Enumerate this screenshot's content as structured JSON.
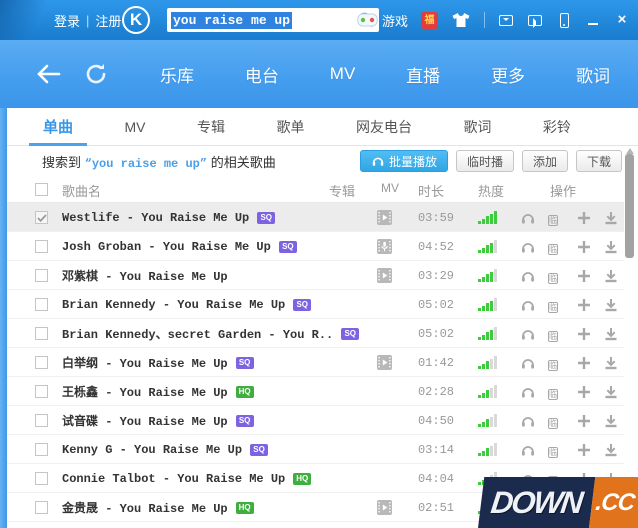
{
  "titlebar": {
    "login": "登录",
    "sep": "|",
    "register": "注册",
    "logo_letter": "K",
    "search": {
      "value": "you raise me up"
    },
    "game_label": "游戏",
    "lucky_glyph": "福"
  },
  "navbar": {
    "items": [
      "乐库",
      "电台",
      "MV",
      "直播",
      "更多",
      "歌词"
    ]
  },
  "tabs": [
    {
      "label": "单曲",
      "active": true
    },
    {
      "label": "MV",
      "active": false
    },
    {
      "label": "专辑",
      "active": false
    },
    {
      "label": "歌单",
      "active": false
    },
    {
      "label": "网友电台",
      "active": false
    },
    {
      "label": "歌词",
      "active": false
    },
    {
      "label": "彩铃",
      "active": false
    }
  ],
  "resultbar": {
    "prefix": "搜索到",
    "query": "“you raise me up”",
    "suffix": "的相关歌曲",
    "buttons": [
      {
        "label": "批量播放",
        "primary": true
      },
      {
        "label": "临时播",
        "primary": false
      },
      {
        "label": "添加",
        "primary": false
      },
      {
        "label": "下载",
        "primary": false
      }
    ]
  },
  "table": {
    "headers": [
      "歌曲名",
      "专辑",
      "MV",
      "时长",
      "热度",
      "操作"
    ],
    "temp_icon_glyph": "临",
    "rows": [
      {
        "title": "Westlife - You Raise Me Up",
        "badge": "SQ",
        "mv": "video",
        "duration": "03:59",
        "heat": 5,
        "checked": true,
        "selected": true
      },
      {
        "title": "Josh Groban - You Raise Me Up",
        "badge": "SQ",
        "mv": "mic",
        "duration": "04:52",
        "heat": 4,
        "checked": false,
        "selected": false
      },
      {
        "title": "邓紫棋 - You Raise Me Up",
        "badge": null,
        "mv": "video",
        "duration": "03:29",
        "heat": 4,
        "checked": false,
        "selected": false
      },
      {
        "title": "Brian Kennedy - You Raise Me Up",
        "badge": "SQ",
        "mv": null,
        "duration": "05:02",
        "heat": 4,
        "checked": false,
        "selected": false
      },
      {
        "title": "Brian Kennedy、secret Garden - You R..",
        "badge": "SQ",
        "mv": null,
        "duration": "05:02",
        "heat": 4,
        "checked": false,
        "selected": false
      },
      {
        "title": "白举纲 - You Raise Me Up",
        "badge": "SQ",
        "mv": "video",
        "duration": "01:42",
        "heat": 3,
        "checked": false,
        "selected": false
      },
      {
        "title": "王栎鑫 - You Raise Me Up",
        "badge": "HQ",
        "mv": null,
        "duration": "02:28",
        "heat": 3,
        "checked": false,
        "selected": false
      },
      {
        "title": "试音碟 - You Raise Me Up",
        "badge": "SQ",
        "mv": null,
        "duration": "04:50",
        "heat": 3,
        "checked": false,
        "selected": false
      },
      {
        "title": "Kenny G - You Raise Me Up",
        "badge": "SQ",
        "mv": null,
        "duration": "03:14",
        "heat": 3,
        "checked": false,
        "selected": false
      },
      {
        "title": "Connie Talbot - You Raise Me Up",
        "badge": "HQ",
        "mv": null,
        "duration": "04:04",
        "heat": 3,
        "checked": false,
        "selected": false
      },
      {
        "title": "金贵晟 - You Raise Me Up",
        "badge": "HQ",
        "mv": "video",
        "duration": "02:51",
        "heat": 3,
        "checked": false,
        "selected": false
      }
    ]
  },
  "watermark": {
    "main": "DOWN",
    "suffix": ".CC"
  },
  "colors": {
    "titlebar_blue": "#1f84d6",
    "navbar_blue": "#449dee",
    "accent_blue": "#3a97e8",
    "primary_button": "#2ea6e6",
    "badge_sq": "#7d63e2",
    "badge_hq": "#3fae3f",
    "heat_green": "#3ecb3e",
    "watermark_navy": "#1b2b4e",
    "watermark_orange": "#e2731d"
  }
}
